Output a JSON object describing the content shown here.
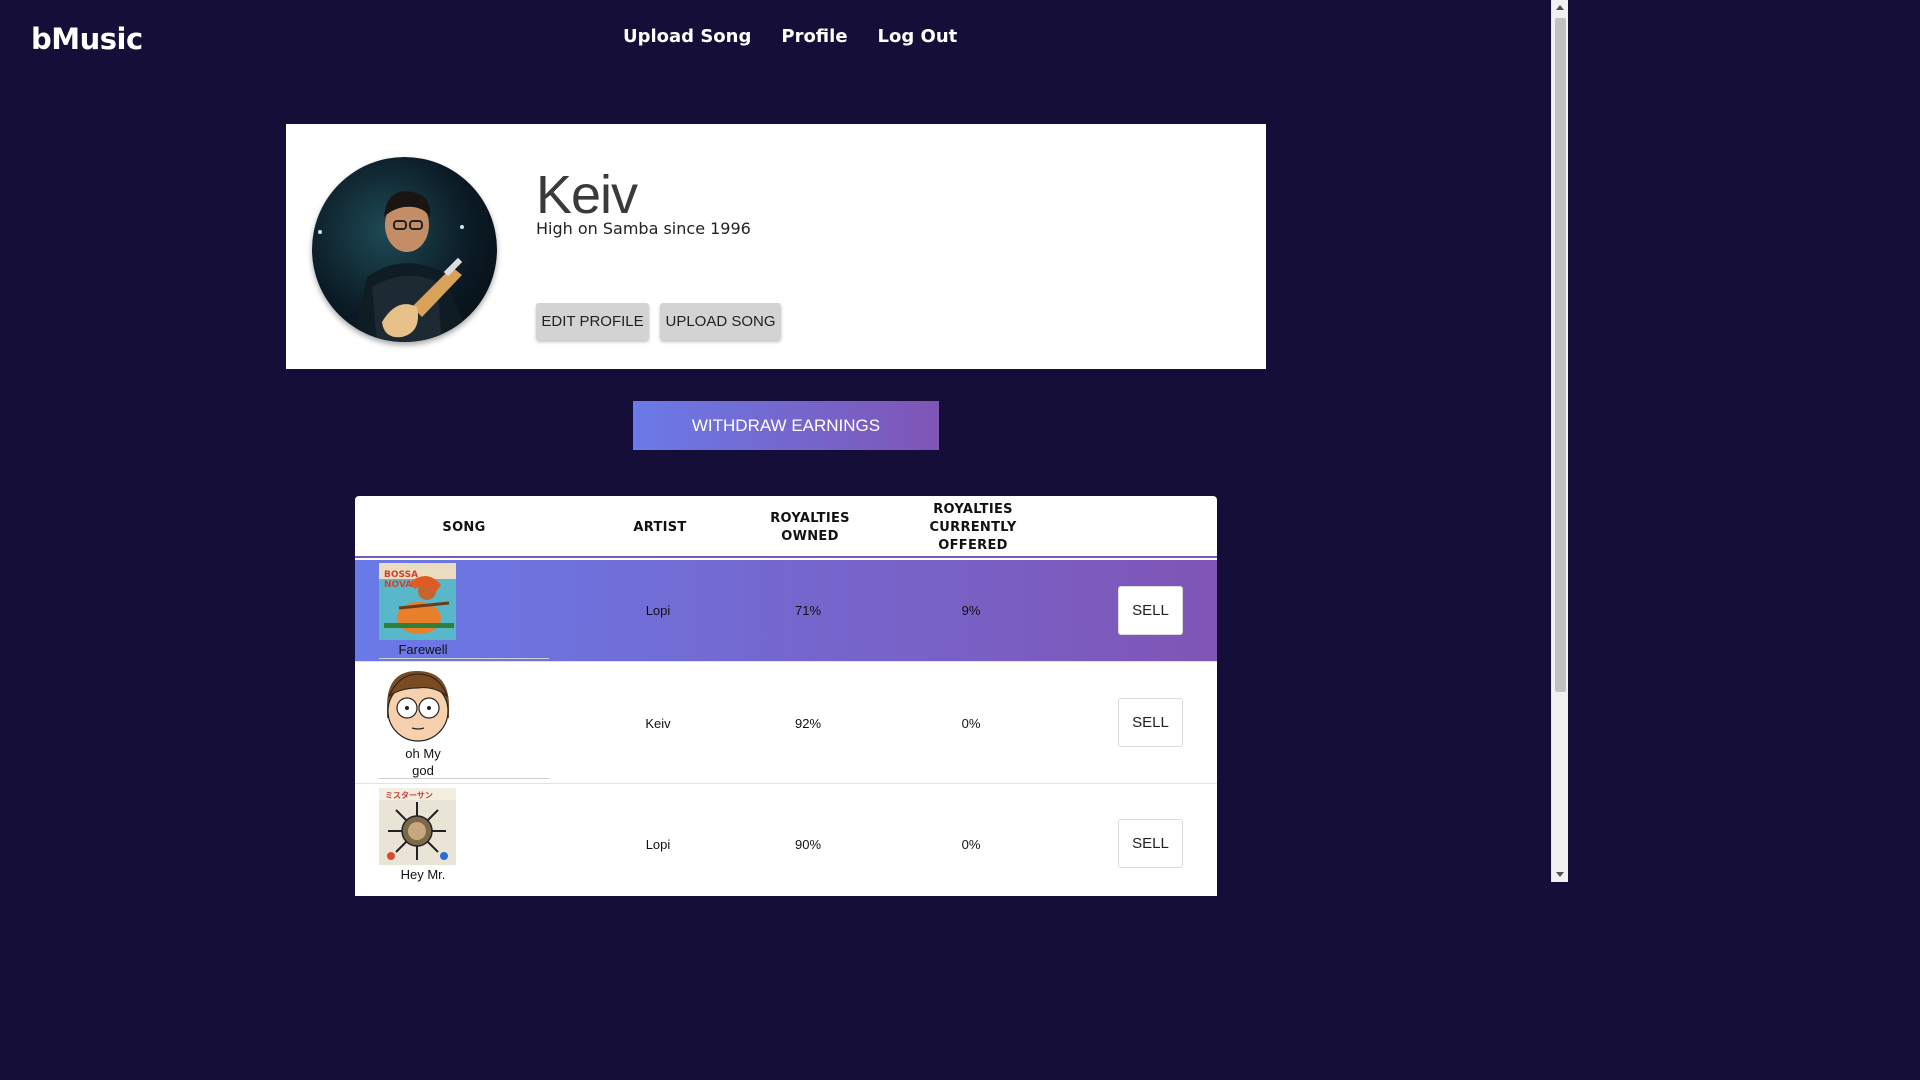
{
  "header": {
    "brand": "bMusic",
    "nav": [
      "Upload Song",
      "Profile",
      "Log Out"
    ]
  },
  "profile": {
    "name": "Keiv",
    "bio": "High on Samba since 1996",
    "edit_label": "EDIT PROFILE",
    "upload_label": "UPLOAD SONG"
  },
  "withdraw_label": "WITHDRAW EARNINGS",
  "table": {
    "headers": {
      "song": "SONG",
      "artist": "ARTIST",
      "owned_1": "ROYALTIES",
      "owned_2": "OWNED",
      "offered_1": "ROYALTIES",
      "offered_2": "CURRENTLY",
      "offered_3": "OFFERED"
    },
    "rows": [
      {
        "song_1": "Farewell",
        "song_2": "",
        "artist": "Lopi",
        "owned": "71%",
        "offered": "9%",
        "sell": "SELL"
      },
      {
        "song_1": "oh My",
        "song_2": "god",
        "artist": "Keiv",
        "owned": "92%",
        "offered": "0%",
        "sell": "SELL"
      },
      {
        "song_1": "Hey Mr.",
        "song_2": "",
        "artist": "Lopi",
        "owned": "90%",
        "offered": "0%",
        "sell": "SELL"
      }
    ]
  },
  "colors": {
    "background": "#140e38",
    "gradient_start": "#6a7ae8",
    "gradient_end": "#7f55b6"
  },
  "icons": [
    "profile-avatar-image",
    "bossa-nova-cover",
    "cartoon-face-cover",
    "sun-cover"
  ]
}
